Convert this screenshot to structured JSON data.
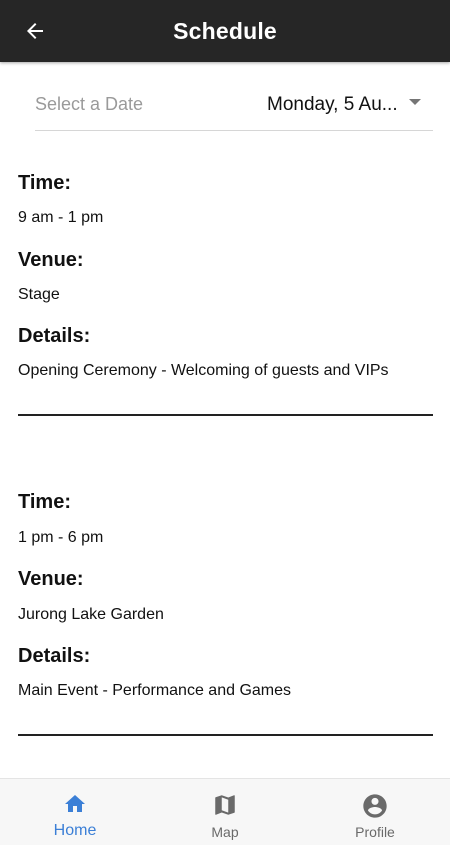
{
  "app_bar": {
    "title": "Schedule"
  },
  "date_picker": {
    "label": "Select a Date",
    "selected_value": "Monday, 5 Au..."
  },
  "events": [
    {
      "time_label": "Time:",
      "time_value": "9 am - 1 pm",
      "venue_label": "Venue:",
      "venue_value": "Stage",
      "details_label": "Details:",
      "details_value": "Opening Ceremony - Welcoming of guests and VIPs"
    },
    {
      "time_label": "Time:",
      "time_value": "1 pm - 6 pm",
      "venue_label": "Venue:",
      "venue_value": "Jurong Lake Garden",
      "details_label": "Details:",
      "details_value": "Main Event - Performance and Games"
    }
  ],
  "bottom_nav": {
    "items": [
      {
        "label": "Home",
        "icon": "home-icon",
        "active": true
      },
      {
        "label": "Map",
        "icon": "map-icon",
        "active": false
      },
      {
        "label": "Profile",
        "icon": "account-circle-icon",
        "active": false
      }
    ]
  },
  "colors": {
    "app_bar_bg": "#262626",
    "active_nav": "#3b7fd6",
    "inactive_nav": "#6a6a6a",
    "placeholder_text": "#9a9a9a"
  }
}
